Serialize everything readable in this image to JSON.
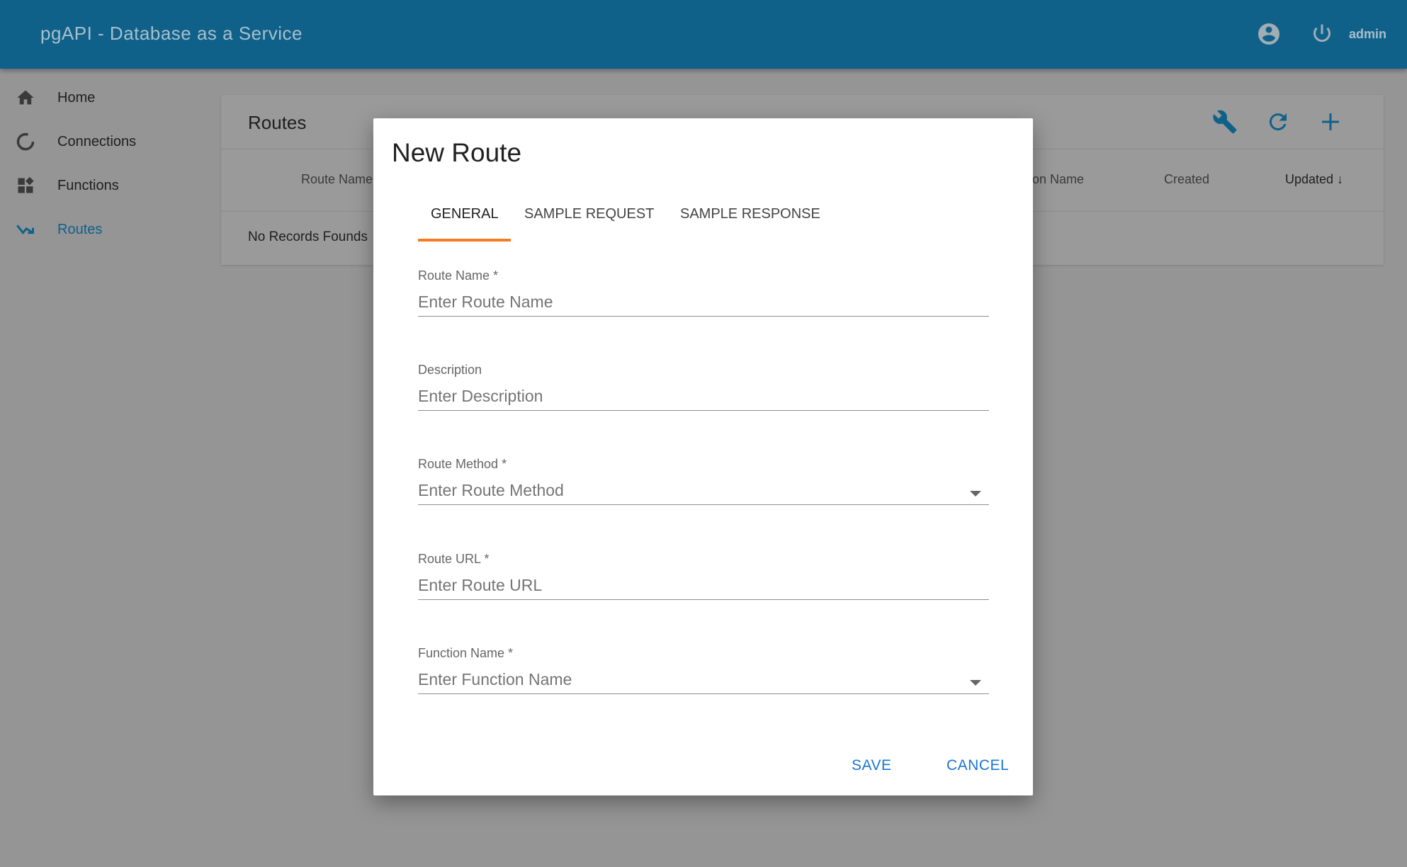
{
  "header": {
    "title": "pgAPI - Database as a Service",
    "user": "admin",
    "icons": [
      "account-circle-icon",
      "power-icon"
    ]
  },
  "sidebar": {
    "items": [
      {
        "label": "Home",
        "icon": "home-icon"
      },
      {
        "label": "Connections",
        "icon": "connections-icon"
      },
      {
        "label": "Functions",
        "icon": "functions-icon"
      },
      {
        "label": "Routes",
        "icon": "routes-icon",
        "active": true
      }
    ]
  },
  "main": {
    "title": "Routes",
    "toolbar": [
      "wrench-icon",
      "refresh-icon",
      "add-icon"
    ],
    "columns": [
      "Route Name",
      "on Name",
      "Created",
      "Updated"
    ],
    "sort_indicator": "↓",
    "empty": "No Records Founds"
  },
  "dialog": {
    "title": "New Route",
    "tabs": [
      "GENERAL",
      "SAMPLE REQUEST",
      "SAMPLE RESPONSE"
    ],
    "fields": [
      {
        "label": "Route Name *",
        "placeholder": "Enter Route Name"
      },
      {
        "label": "Description",
        "placeholder": "Enter Description"
      },
      {
        "label": "Route Method *",
        "placeholder": "Enter Route Method"
      },
      {
        "label": "Route URL *",
        "placeholder": "Enter Route URL"
      },
      {
        "label": "Function Name *",
        "placeholder": "Enter Function Name"
      }
    ],
    "save": "SAVE",
    "cancel": "CANCEL"
  },
  "colors": {
    "header": "#10618a",
    "accent": "#1976d2",
    "tab_indicator": "#f57c1f"
  }
}
